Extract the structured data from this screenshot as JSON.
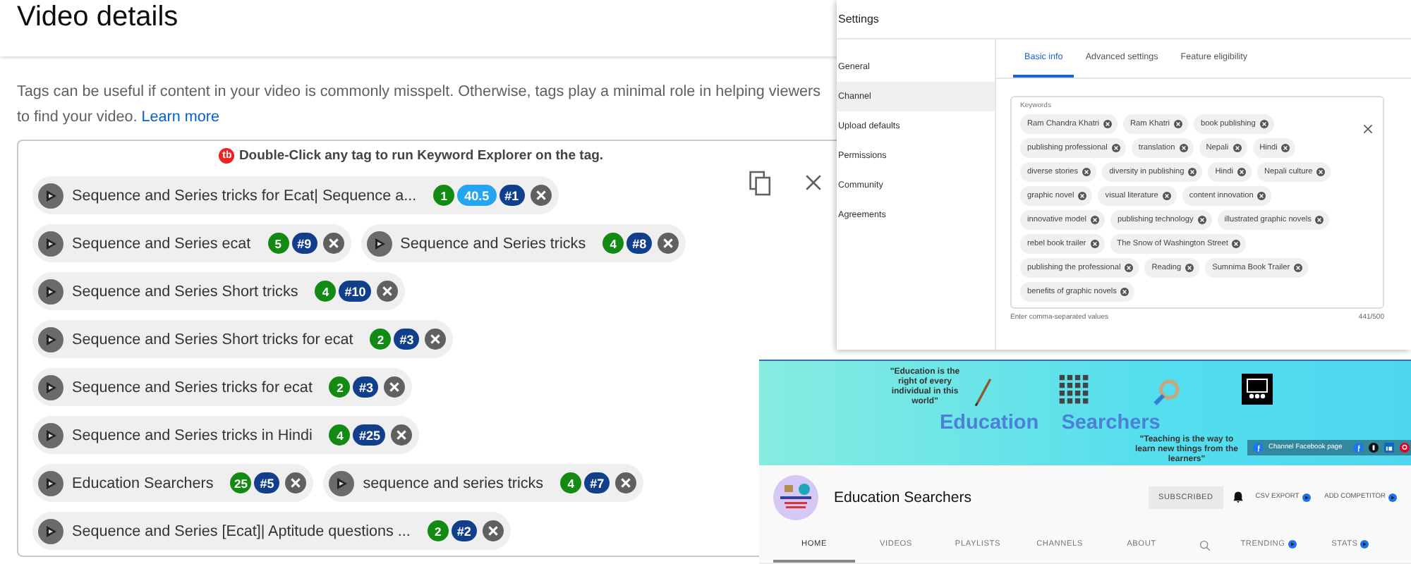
{
  "video_details": {
    "title": "Video details",
    "description": "Tags can be useful if content in your video is commonly misspelt. Otherwise, tags play a minimal role in helping viewers to find your video.",
    "learn_more": "Learn more",
    "hint_badge": "tb",
    "hint": "Double-Click any tag to run Keyword Explorer on the tag.",
    "tag_rows": [
      [
        {
          "label": "Sequence and Series tricks for Ecat| Sequence a...",
          "score": "1",
          "volume": "40.5",
          "rank": "#1"
        }
      ],
      [
        {
          "label": "Sequence and Series ecat",
          "score": "5",
          "rank": "#9"
        },
        {
          "label": "Sequence and Series tricks",
          "score": "4",
          "rank": "#8"
        }
      ],
      [
        {
          "label": "Sequence and Series Short tricks",
          "score": "4",
          "rank": "#10"
        }
      ],
      [
        {
          "label": "Sequence and Series Short tricks for ecat",
          "score": "2",
          "rank": "#3"
        }
      ],
      [
        {
          "label": "Sequence and Series tricks for ecat",
          "score": "2",
          "rank": "#3"
        }
      ],
      [
        {
          "label": "Sequence and Series tricks in Hindi",
          "score": "4",
          "rank": "#25"
        }
      ],
      [
        {
          "label": "Education Searchers",
          "score": "25",
          "rank": "#5"
        },
        {
          "label": "sequence and series tricks",
          "score": "4",
          "rank": "#7"
        }
      ],
      [
        {
          "label": "Sequence and Series [Ecat]| Aptitude questions ...",
          "score": "2",
          "rank": "#2"
        }
      ]
    ]
  },
  "settings": {
    "title": "Settings",
    "sidebar": [
      {
        "label": "General",
        "selected": false
      },
      {
        "label": "Channel",
        "selected": true
      },
      {
        "label": "Upload defaults",
        "selected": false
      },
      {
        "label": "Permissions",
        "selected": false
      },
      {
        "label": "Community",
        "selected": false
      },
      {
        "label": "Agreements",
        "selected": false
      }
    ],
    "tabs": [
      {
        "label": "Basic info",
        "selected": true
      },
      {
        "label": "Advanced settings",
        "selected": false
      },
      {
        "label": "Feature eligibility",
        "selected": false
      }
    ],
    "keywords_label": "Keywords",
    "keyword_rows": [
      [
        "Ram Chandra Khatri",
        "Ram Khatri",
        "book publishing"
      ],
      [
        "publishing professional",
        "translation",
        "Nepali",
        "Hindi"
      ],
      [
        "diverse stories",
        "diversity in publishing",
        "Hindi",
        "Nepali culture"
      ],
      [
        "graphic novel",
        "visual literature",
        "content innovation"
      ],
      [
        "innovative model",
        "publishing technology",
        "illustrated graphic novels"
      ],
      [
        "rebel book trailer",
        "The Snow of Washington Street"
      ],
      [
        "publishing the professional",
        "Reading",
        "Sumnima Book Trailer"
      ],
      [
        "benefits of graphic novels"
      ]
    ],
    "helper": "Enter comma-separated values",
    "counter": "441/500"
  },
  "channel": {
    "banner": {
      "quote_1": "\"Education is the right of every individual in  this world\"",
      "name": "Education    Searchers",
      "quote_2": "\"Teaching is the way to learn new things from the learners\"",
      "facebook": "Channel Facebook page"
    },
    "name": "Education Searchers",
    "subscribe": "SUBSCRIBED",
    "csv_export": "CSV EXPORT",
    "add_competitor": "ADD COMPETITOR",
    "tabs": [
      {
        "label": "HOME",
        "selected": true
      },
      {
        "label": "VIDEOS",
        "selected": false
      },
      {
        "label": "PLAYLISTS",
        "selected": false
      },
      {
        "label": "CHANNELS",
        "selected": false
      },
      {
        "label": "ABOUT",
        "selected": false
      }
    ],
    "extra_tabs": [
      "TRENDING",
      "STATS"
    ]
  }
}
